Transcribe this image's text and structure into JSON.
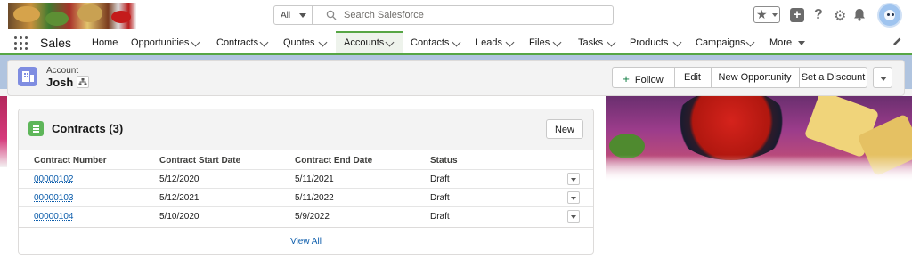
{
  "header": {
    "search_scope": "All",
    "search_placeholder": "Search Salesforce"
  },
  "nav": {
    "app_name": "Sales",
    "items": [
      {
        "label": "Home"
      },
      {
        "label": "Opportunities"
      },
      {
        "label": "Contracts"
      },
      {
        "label": "Quotes"
      },
      {
        "label": "Accounts"
      },
      {
        "label": "Contacts"
      },
      {
        "label": "Leads"
      },
      {
        "label": "Files"
      },
      {
        "label": "Tasks"
      },
      {
        "label": "Products"
      },
      {
        "label": "Campaigns"
      },
      {
        "label": "More"
      }
    ],
    "active": "Accounts"
  },
  "record": {
    "object_label": "Account",
    "name": "Josh",
    "actions": [
      "Follow",
      "Edit",
      "New Opportunity",
      "Set a Discount"
    ]
  },
  "related_list": {
    "title": "Contracts (3)",
    "new_label": "New",
    "columns": [
      "Contract Number",
      "Contract Start Date",
      "Contract End Date",
      "Status"
    ],
    "rows": [
      {
        "number": "00000102",
        "start": "5/12/2020",
        "end": "5/11/2021",
        "status": "Draft"
      },
      {
        "number": "00000103",
        "start": "5/12/2021",
        "end": "5/11/2022",
        "status": "Draft"
      },
      {
        "number": "00000104",
        "start": "5/10/2020",
        "end": "5/9/2022",
        "status": "Draft"
      }
    ],
    "view_all": "View All"
  },
  "colors": {
    "nav_accent": "#57a645",
    "link": "#0b5cab",
    "account_icon": "#7f8de1",
    "contract_icon": "#5eb65a"
  }
}
